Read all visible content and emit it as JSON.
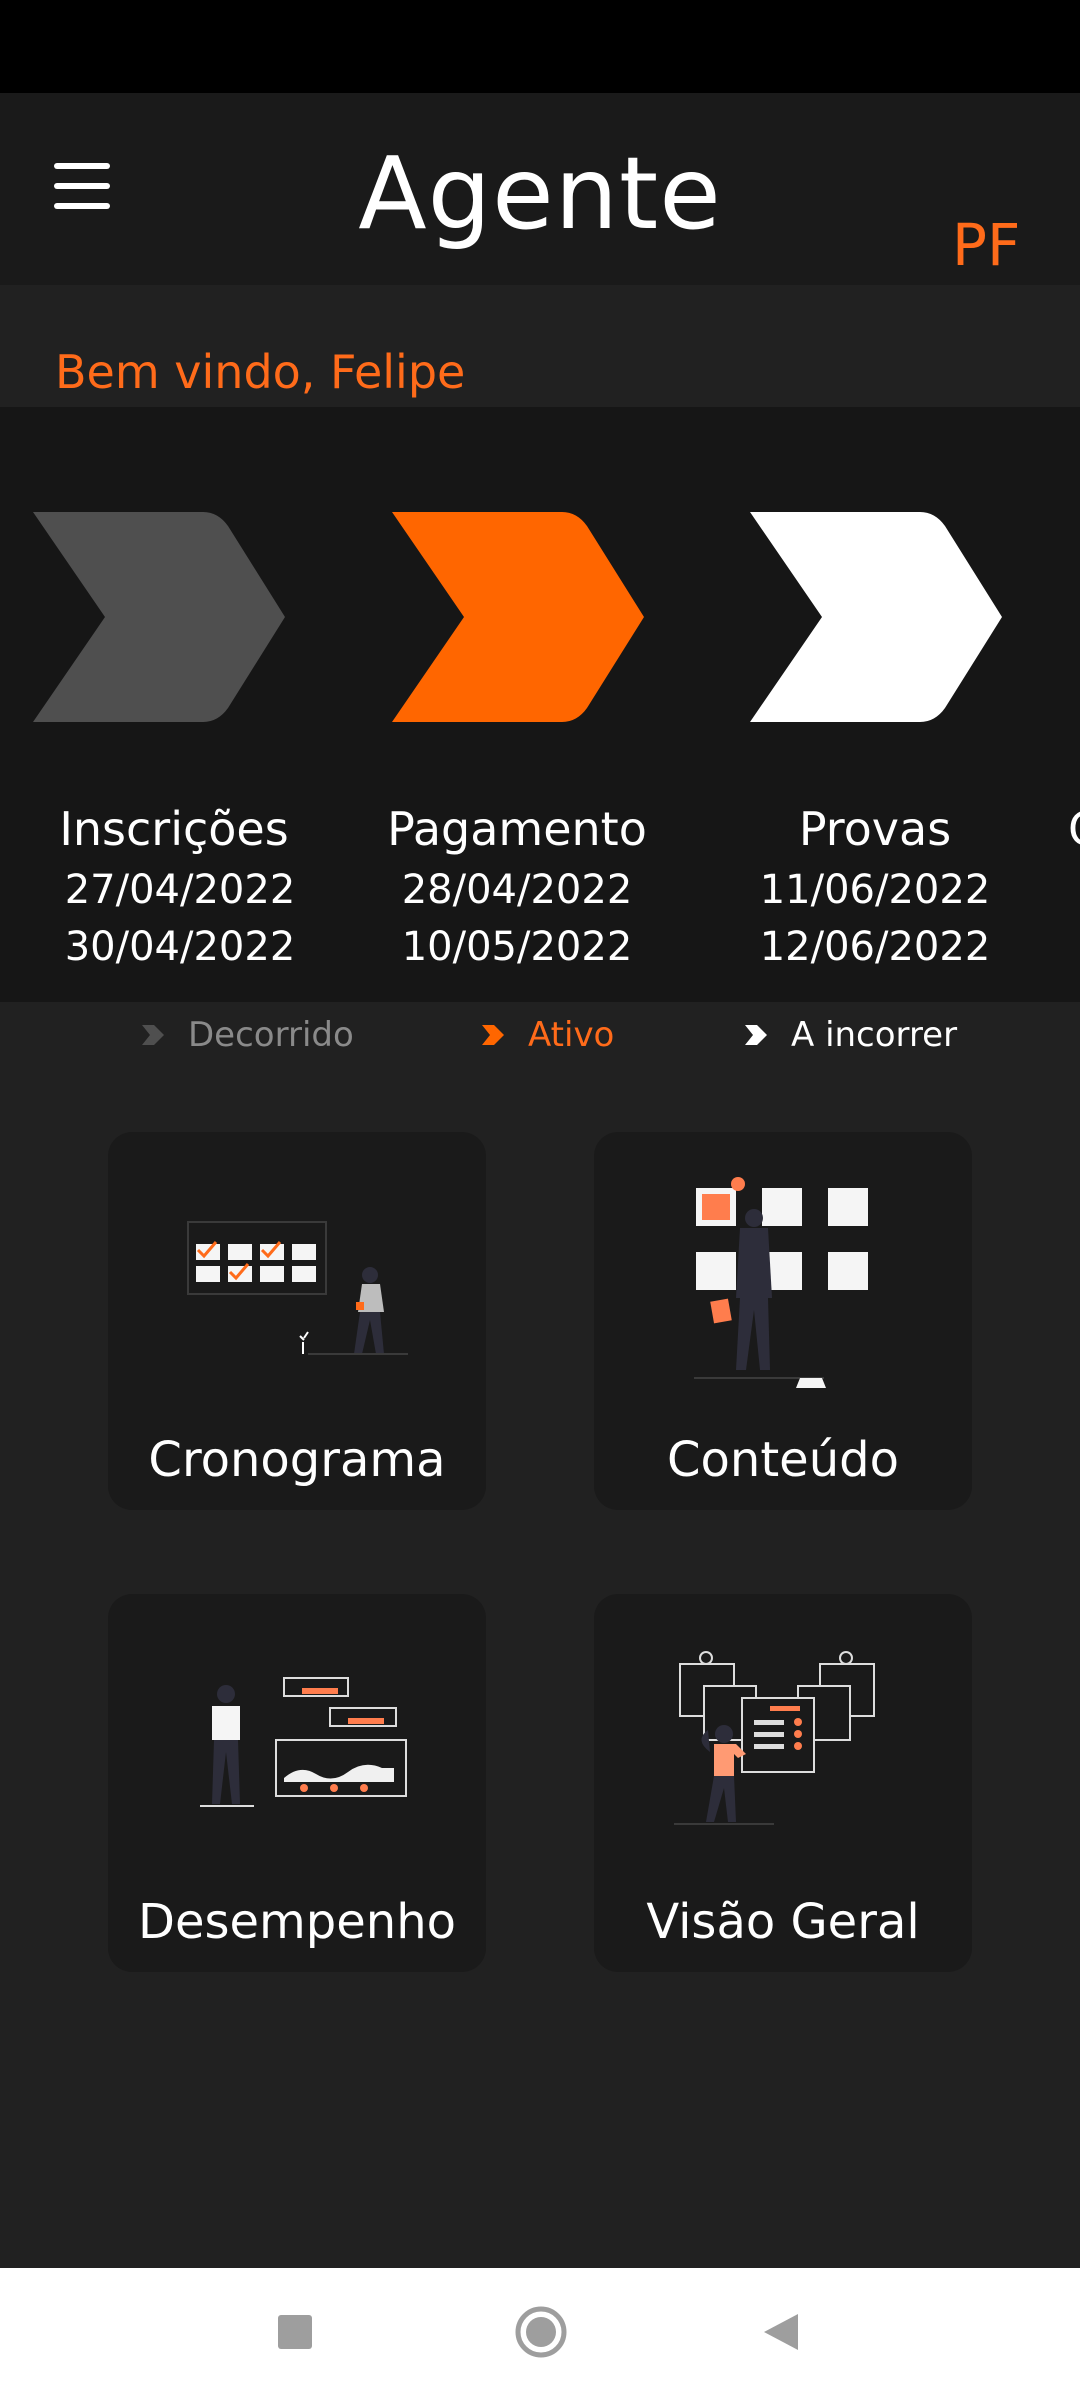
{
  "app": {
    "title": "Agente",
    "avatar_initials": "PF",
    "welcome": "Bem vindo, Felipe",
    "accent_color": "#ff6b1a"
  },
  "timeline": {
    "steps": [
      {
        "name": "Inscrições",
        "start": "27/04/2022",
        "end": "30/04/2022",
        "status": "Decorrido",
        "color": "#4f4f4f"
      },
      {
        "name": "Pagamento",
        "start": "28/04/2022",
        "end": "10/05/2022",
        "status": "Ativo",
        "color": "#ff6600"
      },
      {
        "name": "Provas",
        "start": "11/06/2022",
        "end": "12/06/2022",
        "status": "A incorrer",
        "color": "#ffffff"
      }
    ],
    "legend": [
      {
        "label": "Decorrido",
        "color": "#8a8a8a",
        "icon": "chevron-gray-icon"
      },
      {
        "label": "Ativo",
        "color": "#ff6b1a",
        "icon": "chevron-orange-icon"
      },
      {
        "label": "A incorrer",
        "color": "#ffffff",
        "icon": "chevron-white-icon"
      }
    ]
  },
  "menu_cards": [
    {
      "label": "Cronograma",
      "icon": "calendar-illustration"
    },
    {
      "label": "Conteúdo",
      "icon": "content-illustration"
    },
    {
      "label": "Desempenho",
      "icon": "performance-illustration"
    },
    {
      "label": "Visão Geral",
      "icon": "overview-illustration"
    }
  ],
  "nav": {
    "icons": [
      "recents-square-icon",
      "home-circle-icon",
      "back-triangle-icon"
    ]
  }
}
